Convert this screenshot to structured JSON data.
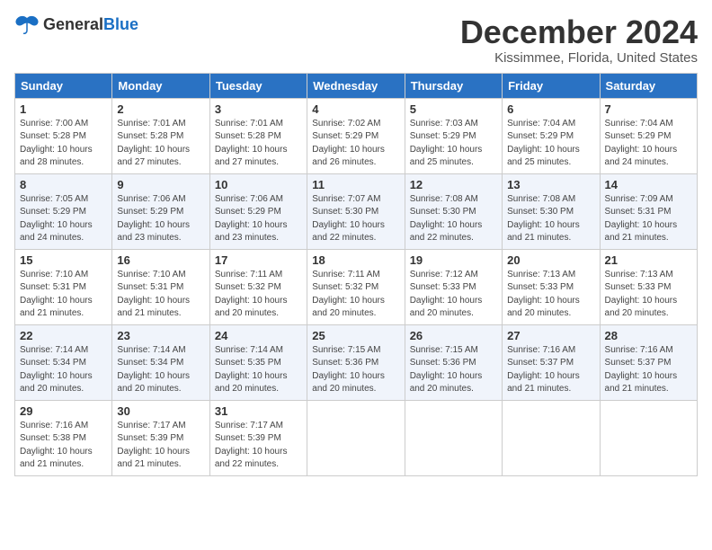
{
  "logo": {
    "general": "General",
    "blue": "Blue"
  },
  "title": "December 2024",
  "location": "Kissimmee, Florida, United States",
  "days_of_week": [
    "Sunday",
    "Monday",
    "Tuesday",
    "Wednesday",
    "Thursday",
    "Friday",
    "Saturday"
  ],
  "weeks": [
    [
      {
        "day": "1",
        "info": "Sunrise: 7:00 AM\nSunset: 5:28 PM\nDaylight: 10 hours\nand 28 minutes."
      },
      {
        "day": "2",
        "info": "Sunrise: 7:01 AM\nSunset: 5:28 PM\nDaylight: 10 hours\nand 27 minutes."
      },
      {
        "day": "3",
        "info": "Sunrise: 7:01 AM\nSunset: 5:28 PM\nDaylight: 10 hours\nand 27 minutes."
      },
      {
        "day": "4",
        "info": "Sunrise: 7:02 AM\nSunset: 5:29 PM\nDaylight: 10 hours\nand 26 minutes."
      },
      {
        "day": "5",
        "info": "Sunrise: 7:03 AM\nSunset: 5:29 PM\nDaylight: 10 hours\nand 25 minutes."
      },
      {
        "day": "6",
        "info": "Sunrise: 7:04 AM\nSunset: 5:29 PM\nDaylight: 10 hours\nand 25 minutes."
      },
      {
        "day": "7",
        "info": "Sunrise: 7:04 AM\nSunset: 5:29 PM\nDaylight: 10 hours\nand 24 minutes."
      }
    ],
    [
      {
        "day": "8",
        "info": "Sunrise: 7:05 AM\nSunset: 5:29 PM\nDaylight: 10 hours\nand 24 minutes."
      },
      {
        "day": "9",
        "info": "Sunrise: 7:06 AM\nSunset: 5:29 PM\nDaylight: 10 hours\nand 23 minutes."
      },
      {
        "day": "10",
        "info": "Sunrise: 7:06 AM\nSunset: 5:29 PM\nDaylight: 10 hours\nand 23 minutes."
      },
      {
        "day": "11",
        "info": "Sunrise: 7:07 AM\nSunset: 5:30 PM\nDaylight: 10 hours\nand 22 minutes."
      },
      {
        "day": "12",
        "info": "Sunrise: 7:08 AM\nSunset: 5:30 PM\nDaylight: 10 hours\nand 22 minutes."
      },
      {
        "day": "13",
        "info": "Sunrise: 7:08 AM\nSunset: 5:30 PM\nDaylight: 10 hours\nand 21 minutes."
      },
      {
        "day": "14",
        "info": "Sunrise: 7:09 AM\nSunset: 5:31 PM\nDaylight: 10 hours\nand 21 minutes."
      }
    ],
    [
      {
        "day": "15",
        "info": "Sunrise: 7:10 AM\nSunset: 5:31 PM\nDaylight: 10 hours\nand 21 minutes."
      },
      {
        "day": "16",
        "info": "Sunrise: 7:10 AM\nSunset: 5:31 PM\nDaylight: 10 hours\nand 21 minutes."
      },
      {
        "day": "17",
        "info": "Sunrise: 7:11 AM\nSunset: 5:32 PM\nDaylight: 10 hours\nand 20 minutes."
      },
      {
        "day": "18",
        "info": "Sunrise: 7:11 AM\nSunset: 5:32 PM\nDaylight: 10 hours\nand 20 minutes."
      },
      {
        "day": "19",
        "info": "Sunrise: 7:12 AM\nSunset: 5:33 PM\nDaylight: 10 hours\nand 20 minutes."
      },
      {
        "day": "20",
        "info": "Sunrise: 7:13 AM\nSunset: 5:33 PM\nDaylight: 10 hours\nand 20 minutes."
      },
      {
        "day": "21",
        "info": "Sunrise: 7:13 AM\nSunset: 5:33 PM\nDaylight: 10 hours\nand 20 minutes."
      }
    ],
    [
      {
        "day": "22",
        "info": "Sunrise: 7:14 AM\nSunset: 5:34 PM\nDaylight: 10 hours\nand 20 minutes."
      },
      {
        "day": "23",
        "info": "Sunrise: 7:14 AM\nSunset: 5:34 PM\nDaylight: 10 hours\nand 20 minutes."
      },
      {
        "day": "24",
        "info": "Sunrise: 7:14 AM\nSunset: 5:35 PM\nDaylight: 10 hours\nand 20 minutes."
      },
      {
        "day": "25",
        "info": "Sunrise: 7:15 AM\nSunset: 5:36 PM\nDaylight: 10 hours\nand 20 minutes."
      },
      {
        "day": "26",
        "info": "Sunrise: 7:15 AM\nSunset: 5:36 PM\nDaylight: 10 hours\nand 20 minutes."
      },
      {
        "day": "27",
        "info": "Sunrise: 7:16 AM\nSunset: 5:37 PM\nDaylight: 10 hours\nand 21 minutes."
      },
      {
        "day": "28",
        "info": "Sunrise: 7:16 AM\nSunset: 5:37 PM\nDaylight: 10 hours\nand 21 minutes."
      }
    ],
    [
      {
        "day": "29",
        "info": "Sunrise: 7:16 AM\nSunset: 5:38 PM\nDaylight: 10 hours\nand 21 minutes."
      },
      {
        "day": "30",
        "info": "Sunrise: 7:17 AM\nSunset: 5:39 PM\nDaylight: 10 hours\nand 21 minutes."
      },
      {
        "day": "31",
        "info": "Sunrise: 7:17 AM\nSunset: 5:39 PM\nDaylight: 10 hours\nand 22 minutes."
      },
      {
        "day": "",
        "info": ""
      },
      {
        "day": "",
        "info": ""
      },
      {
        "day": "",
        "info": ""
      },
      {
        "day": "",
        "info": ""
      }
    ]
  ]
}
